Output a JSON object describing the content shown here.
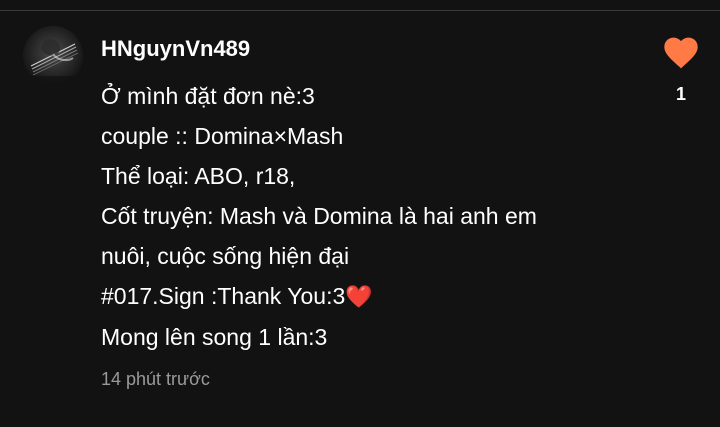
{
  "comment": {
    "username": "HNguynVn489",
    "lines": [
      "Ở mình đặt đơn nè:3",
      "couple :: Domina×Mash",
      "Thể loại: ABO, r18,",
      "Cốt truyện: Mash và Domina là hai anh em",
      "nuôi, cuộc sống hiện đại",
      "#017.Sign :Thank You:3",
      "Mong lên song 1 lần:3"
    ],
    "inline_emoji": "❤️",
    "timestamp": "14 phút trước",
    "like_count": "1"
  },
  "icons": {
    "like": "heart-icon",
    "inline": "red-heart-emoji",
    "avatar": "guitar-photo-avatar"
  },
  "colors": {
    "background": "#121212",
    "text": "#ffffff",
    "muted_text": "#9a9a9a",
    "like_heart": "#ff7a45",
    "emoji_heart": "#e53935"
  }
}
